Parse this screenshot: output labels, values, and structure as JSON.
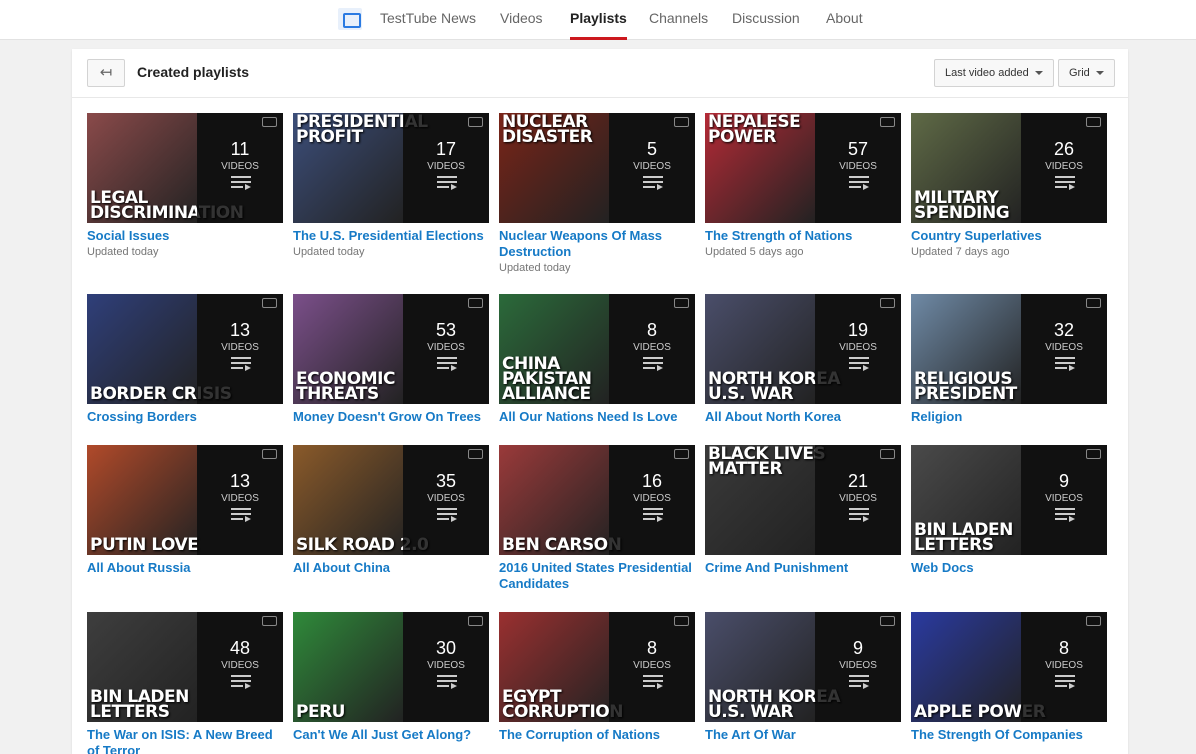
{
  "nav": {
    "tabs": [
      {
        "label": "TestTube News",
        "active": false
      },
      {
        "label": "Videos",
        "active": false
      },
      {
        "label": "Playlists",
        "active": true
      },
      {
        "label": "Channels",
        "active": false
      },
      {
        "label": "Discussion",
        "active": false
      },
      {
        "label": "About",
        "active": false
      }
    ],
    "accent": "#cc181e"
  },
  "header": {
    "back_icon": "back-arrow-icon",
    "back_glyph": "↤",
    "title": "Created playlists",
    "sort_label": "Last video added",
    "view_label": "Grid"
  },
  "overlay_label": "VIDEOS",
  "playlists": [
    {
      "title": "Social Issues",
      "updated": "Updated today",
      "count": "11",
      "caption": "LEGAL DISCRIMINATION",
      "bg": "#8a4a4a",
      "caption_pos": "bottom"
    },
    {
      "title": "The U.S. Presidential Elections",
      "updated": "Updated today",
      "count": "17",
      "caption": "PRESIDENTIAL PROFIT",
      "bg": "#3c4e7a",
      "caption_pos": "top"
    },
    {
      "title": "Nuclear Weapons Of Mass Destruction",
      "updated": "Updated today",
      "count": "5",
      "caption": "NUCLEAR DISASTER",
      "bg": "#7a2418",
      "caption_pos": "top"
    },
    {
      "title": "The Strength of Nations",
      "updated": "Updated 5 days ago",
      "count": "57",
      "caption": "NEPALESE POWER",
      "bg": "#b52a36",
      "caption_pos": "top"
    },
    {
      "title": "Country Superlatives",
      "updated": "Updated 7 days ago",
      "count": "26",
      "caption": "MILITARY SPENDING",
      "bg": "#5f6a46",
      "caption_pos": "bottom"
    },
    {
      "title": "Crossing Borders",
      "updated": "",
      "count": "13",
      "caption": "BORDER CRISIS",
      "bg": "#2f3f7a",
      "caption_pos": "bottom"
    },
    {
      "title": "Money Doesn't Grow On Trees",
      "updated": "",
      "count": "53",
      "caption": "ECONOMIC THREATS",
      "bg": "#7b4f8a",
      "caption_pos": "bottom"
    },
    {
      "title": "All Our Nations Need Is Love",
      "updated": "",
      "count": "8",
      "caption": "CHINA PAKISTAN ALLIANCE",
      "bg": "#2b6a3a",
      "caption_pos": "bottom"
    },
    {
      "title": "All About North Korea",
      "updated": "",
      "count": "19",
      "caption": "NORTH KOREA U.S. WAR",
      "bg": "#4a4e6a",
      "caption_pos": "bottom"
    },
    {
      "title": "Religion",
      "updated": "",
      "count": "32",
      "caption": "RELIGIOUS PRESIDENT",
      "bg": "#6f8aa6",
      "caption_pos": "bottom"
    },
    {
      "title": "All About Russia",
      "updated": "",
      "count": "13",
      "caption": "PUTIN LOVE",
      "bg": "#b14a2a",
      "caption_pos": "bottom"
    },
    {
      "title": "All About China",
      "updated": "",
      "count": "35",
      "caption": "SILK ROAD 2.0",
      "bg": "#8a5a2a",
      "caption_pos": "bottom"
    },
    {
      "title": "2016 United States Presidential Candidates",
      "updated": "",
      "count": "16",
      "caption": "BEN CARSON",
      "bg": "#9a3a3a",
      "caption_pos": "bottom"
    },
    {
      "title": "Crime And Punishment",
      "updated": "",
      "count": "21",
      "caption": "BLACK LIVES MATTER",
      "bg": "#3a3a3a",
      "caption_pos": "top"
    },
    {
      "title": "Web Docs",
      "updated": "",
      "count": "9",
      "caption": "BIN LADEN LETTERS",
      "bg": "#4a4a4a",
      "caption_pos": "bottom"
    },
    {
      "title": "The War on ISIS: A New Breed of Terror",
      "updated": "",
      "count": "48",
      "caption": "BIN LADEN LETTERS",
      "bg": "#3e3e3e",
      "caption_pos": "bottom"
    },
    {
      "title": "Can't We All Just Get Along?",
      "updated": "",
      "count": "30",
      "caption": "PERU",
      "bg": "#2f8a3a",
      "caption_pos": "bottom"
    },
    {
      "title": "The Corruption of Nations",
      "updated": "",
      "count": "8",
      "caption": "EGYPT CORRUPTION",
      "bg": "#9a3030",
      "caption_pos": "bottom"
    },
    {
      "title": "The Art Of War",
      "updated": "",
      "count": "9",
      "caption": "NORTH KOREA U.S. WAR",
      "bg": "#4a4e6a",
      "caption_pos": "bottom"
    },
    {
      "title": "The Strength Of Companies",
      "updated": "",
      "count": "8",
      "caption": "APPLE POWER",
      "bg": "#2a3aa0",
      "caption_pos": "bottom"
    }
  ]
}
